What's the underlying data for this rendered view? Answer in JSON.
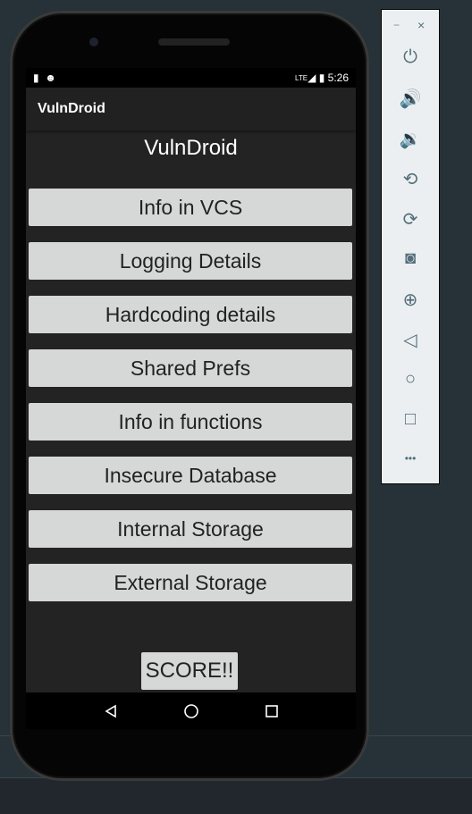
{
  "status_bar": {
    "time": "5:26",
    "network": "LTE"
  },
  "app_bar": {
    "title": "VulnDroid"
  },
  "main": {
    "heading": "VulnDroid",
    "buttons": [
      "Info in VCS",
      "Logging Details",
      "Hardcoding details",
      "Shared Prefs",
      "Info in functions",
      "Insecure Database",
      "Internal Storage",
      "External Storage"
    ],
    "score_label": "SCORE!!"
  },
  "emulator_panel": {
    "minimize": "−",
    "close": "×",
    "more": "•••"
  }
}
